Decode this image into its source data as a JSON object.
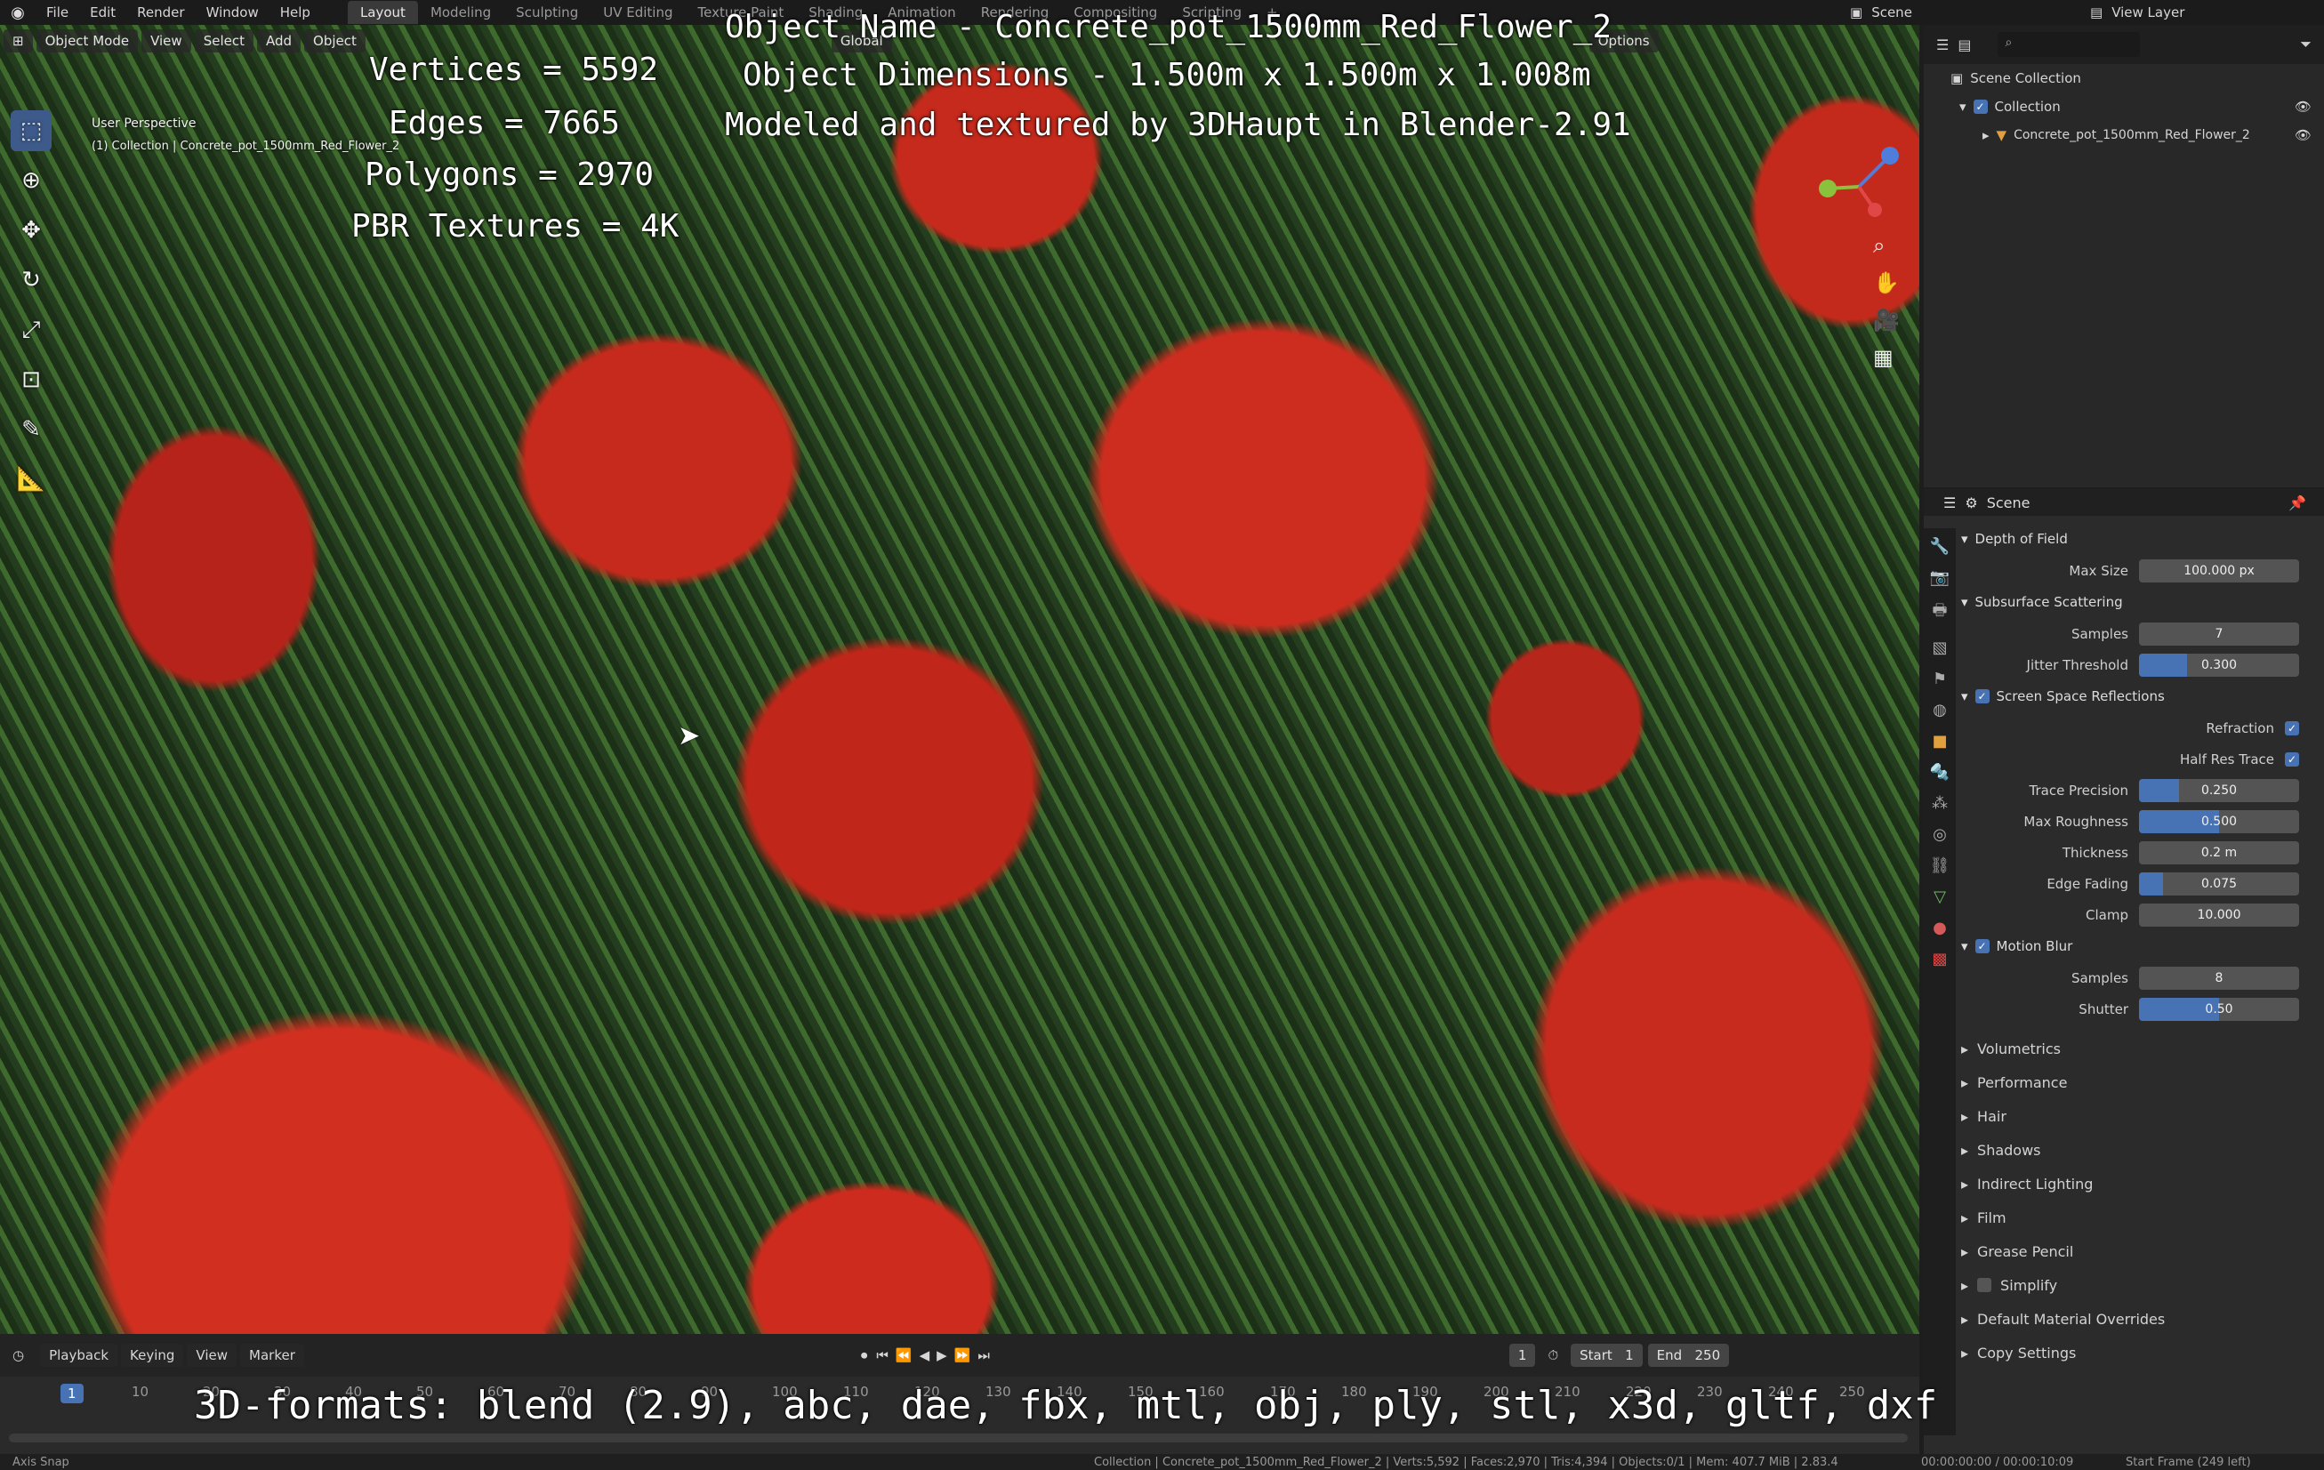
{
  "menubar": {
    "items": [
      "File",
      "Edit",
      "Render",
      "Window",
      "Help"
    ],
    "workspaces": [
      "Layout",
      "Modeling",
      "Sculpting",
      "UV Editing",
      "Texture Paint",
      "Shading",
      "Animation",
      "Rendering",
      "Compositing",
      "Scripting"
    ],
    "scene": "Scene",
    "view_layer": "View Layer"
  },
  "viewport": {
    "mode": "Object Mode",
    "menus": [
      "View",
      "Select",
      "Add",
      "Object"
    ],
    "orientation": "Global",
    "options": "Options",
    "perspective": "User Perspective",
    "object_line": "(1) Collection | Concrete_pot_1500mm_Red_Flower_2"
  },
  "overlay": {
    "vertices": "Vertices = 5592",
    "edges": "Edges = 7665",
    "polygons": "Polygons = 2970",
    "textures": "PBR Textures = 4K",
    "name": "Object Name - Concrete_pot_1500mm_Red_Flower_2",
    "dimensions": "Object Dimensions -  1.500m x 1.500m x 1.008m",
    "credit": "Modeled and textured by 3DHaupt in Blender-2.91",
    "formats": "3D-formats: blend (2.9), abc, dae, fbx, mtl, obj, ply, stl, x3d, gltf, dxf"
  },
  "outliner": {
    "root": "Scene Collection",
    "collection": "Collection",
    "object": "Concrete_pot_1500mm_Red_Flower_2"
  },
  "properties": {
    "context": "Scene",
    "dof": {
      "title": "Depth of Field",
      "max_size_label": "Max Size",
      "max_size": "100.000 px"
    },
    "sss": {
      "title": "Subsurface Scattering",
      "samples_label": "Samples",
      "samples": "7",
      "jitter_label": "Jitter Threshold",
      "jitter": "0.300",
      "jitter_frac": 0.3
    },
    "ssr": {
      "title": "Screen Space Reflections",
      "refraction": "Refraction",
      "half_res": "Half Res Trace",
      "trace_label": "Trace Precision",
      "trace": "0.250",
      "trace_frac": 0.25,
      "rough_label": "Max Roughness",
      "rough": "0.500",
      "rough_frac": 0.5,
      "thick_label": "Thickness",
      "thick": "0.2 m",
      "fade_label": "Edge Fading",
      "fade": "0.075",
      "fade_frac": 0.15,
      "clamp_label": "Clamp",
      "clamp": "10.000"
    },
    "mblur": {
      "title": "Motion Blur",
      "samples_label": "Samples",
      "samples": "8",
      "shutter_label": "Shutter",
      "shutter": "0.50",
      "shutter_frac": 0.5
    },
    "collapsed": [
      "Volumetrics",
      "Performance",
      "Hair",
      "Shadows",
      "Indirect Lighting",
      "Film",
      "Grease Pencil",
      "Simplify",
      "Default Material Overrides",
      "Copy Settings"
    ]
  },
  "timeline": {
    "menus": [
      "Playback",
      "Keying",
      "View",
      "Marker"
    ],
    "current": "1",
    "start_label": "Start",
    "start": "1",
    "end_label": "End",
    "end": "250",
    "ruler": [
      "1",
      "10",
      "20",
      "30",
      "40",
      "50",
      "60",
      "70",
      "80",
      "90",
      "100",
      "110",
      "120",
      "130",
      "140",
      "150",
      "160",
      "170",
      "180",
      "190",
      "200",
      "210",
      "220",
      "230",
      "240",
      "250"
    ]
  },
  "statusbar": {
    "left": "Axis Snap",
    "center": "Collection | Concrete_pot_1500mm_Red_Flower_2 | Verts:5,592 | Faces:2,970 | Tris:4,394 | Objects:0/1 | Mem: 407.7 MiB | 2.83.4",
    "time": "00:00:00:00 / 00:00:10:09",
    "frame": "Start Frame (249 left)"
  }
}
